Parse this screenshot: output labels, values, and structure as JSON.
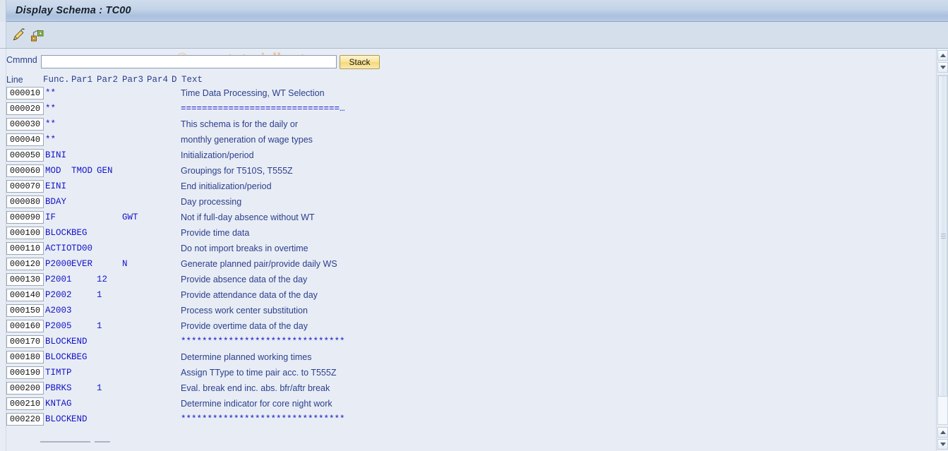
{
  "window": {
    "title": "Display Schema : TC00"
  },
  "toolbar": {
    "display_button_label": "Display/Change",
    "structure_button_label": "Structure"
  },
  "watermark": {
    "text": "© www.tutorialkart.com"
  },
  "command": {
    "label": "Cmmnd",
    "value": "",
    "placeholder": "",
    "stack_button_label": "Stack"
  },
  "table": {
    "headers": {
      "line": "Line",
      "func": "Func.",
      "par1": "Par1",
      "par2": "Par2",
      "par3": "Par3",
      "par4": "Par4",
      "d": "D",
      "text": "Text"
    },
    "rows": [
      {
        "line": "000010",
        "func": "**",
        "par1": "",
        "par2": "",
        "par3": "",
        "par4": "",
        "d": "",
        "text": "Time Data Processing, WT Selection",
        "symbol": false
      },
      {
        "line": "000020",
        "func": "**",
        "par1": "",
        "par2": "",
        "par3": "",
        "par4": "",
        "d": "",
        "text": "==============================…",
        "symbol": true
      },
      {
        "line": "000030",
        "func": "**",
        "par1": "",
        "par2": "",
        "par3": "",
        "par4": "",
        "d": "",
        "text": "This schema is for the daily or",
        "symbol": false
      },
      {
        "line": "000040",
        "func": "**",
        "par1": "",
        "par2": "",
        "par3": "",
        "par4": "",
        "d": "",
        "text": "monthly generation of wage types",
        "symbol": false
      },
      {
        "line": "000050",
        "func": "BINI",
        "par1": "",
        "par2": "",
        "par3": "",
        "par4": "",
        "d": "",
        "text": "Initialization/period",
        "symbol": false
      },
      {
        "line": "000060",
        "func": "MOD",
        "par1": "TMOD",
        "par2": "GEN",
        "par3": "",
        "par4": "",
        "d": "",
        "text": "Groupings for T510S, T555Z",
        "symbol": false
      },
      {
        "line": "000070",
        "func": "EINI",
        "par1": "",
        "par2": "",
        "par3": "",
        "par4": "",
        "d": "",
        "text": "End initialization/period",
        "symbol": false
      },
      {
        "line": "000080",
        "func": "BDAY",
        "par1": "",
        "par2": "",
        "par3": "",
        "par4": "",
        "d": "",
        "text": "Day processing",
        "symbol": false
      },
      {
        "line": "000090",
        "func": "IF",
        "par1": "",
        "par2": "",
        "par3": "GWT",
        "par4": "",
        "d": "",
        "text": "Not if full-day absence without WT",
        "symbol": false
      },
      {
        "line": "000100",
        "func": "BLOCK",
        "par1": "BEG",
        "par2": "",
        "par3": "",
        "par4": "",
        "d": "",
        "text": "Provide time data",
        "symbol": false
      },
      {
        "line": "000110",
        "func": "ACTIO",
        "par1": "TD00",
        "par2": "",
        "par3": "",
        "par4": "",
        "d": "",
        "text": "Do not import breaks in overtime",
        "symbol": false
      },
      {
        "line": "000120",
        "func": "P2000",
        "par1": "EVER",
        "par2": "",
        "par3": "N",
        "par4": "",
        "d": "",
        "text": "Generate planned pair/provide daily WS",
        "symbol": false
      },
      {
        "line": "000130",
        "func": "P2001",
        "par1": "",
        "par2": "12",
        "par3": "",
        "par4": "",
        "d": "",
        "text": "Provide absence data of the day",
        "symbol": false
      },
      {
        "line": "000140",
        "func": "P2002",
        "par1": "",
        "par2": "1",
        "par3": "",
        "par4": "",
        "d": "",
        "text": "Provide attendance data of the day",
        "symbol": false
      },
      {
        "line": "000150",
        "func": "A2003",
        "par1": "",
        "par2": "",
        "par3": "",
        "par4": "",
        "d": "",
        "text": "Process work center substitution",
        "symbol": false
      },
      {
        "line": "000160",
        "func": "P2005",
        "par1": "",
        "par2": "1",
        "par3": "",
        "par4": "",
        "d": "",
        "text": "Provide overtime data of the day",
        "symbol": false
      },
      {
        "line": "000170",
        "func": "BLOCK",
        "par1": "END",
        "par2": "",
        "par3": "",
        "par4": "",
        "d": "",
        "text": "*******************************",
        "symbol": true
      },
      {
        "line": "000180",
        "func": "BLOCK",
        "par1": "BEG",
        "par2": "",
        "par3": "",
        "par4": "",
        "d": "",
        "text": "Determine planned working times",
        "symbol": false
      },
      {
        "line": "000190",
        "func": "TIMTP",
        "par1": "",
        "par2": "",
        "par3": "",
        "par4": "",
        "d": "",
        "text": "Assign TType to time pair acc. to T555Z",
        "symbol": false
      },
      {
        "line": "000200",
        "func": "PBRKS",
        "par1": "",
        "par2": "1",
        "par3": "",
        "par4": "",
        "d": "",
        "text": "Eval. break end inc. abs. bfr/aftr break",
        "symbol": false
      },
      {
        "line": "000210",
        "func": "KNTAG",
        "par1": "",
        "par2": "",
        "par3": "",
        "par4": "",
        "d": "",
        "text": "Determine indicator for core night work",
        "symbol": false
      },
      {
        "line": "000220",
        "func": "BLOCK",
        "par1": "END",
        "par2": "",
        "par3": "",
        "par4": "",
        "d": "",
        "text": "*******************************",
        "symbol": true
      }
    ]
  },
  "scrollbar": {
    "up_arrow_label": "Scroll up",
    "down_arrow_label": "Scroll down"
  },
  "colors": {
    "title_bar": "#b9cbe3",
    "page_background": "#e8edf5",
    "label_blue": "#2b3e8c",
    "code_blue": "#1414c8",
    "accent_button": "#f4d878",
    "watermark": "#f0c18c"
  }
}
